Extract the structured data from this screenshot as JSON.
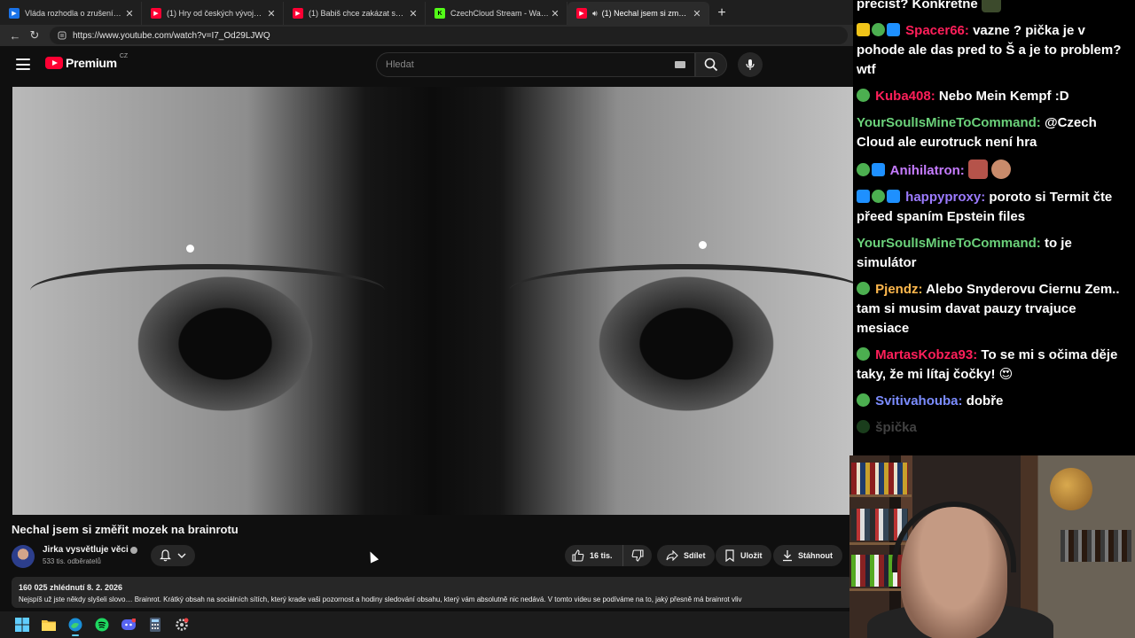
{
  "browser": {
    "tabs": [
      {
        "title": "Vláda rozhodla o zrušení Národ",
        "favicon_color": "#1a73e8",
        "favicon_glyph": "▶",
        "active": false
      },
      {
        "title": "(1) Hry od českých vývojářů dobyv",
        "favicon_color": "#ff0033",
        "favicon_glyph": "▶",
        "active": false
      },
      {
        "title": "(1) Babiš chce zakázat sociální sítě",
        "favicon_color": "#ff0033",
        "favicon_glyph": "▶",
        "active": false
      },
      {
        "title": "CzechCloud Stream - Watch Live o",
        "favicon_color": "#53fc18",
        "favicon_glyph": "K",
        "active": false
      },
      {
        "title": "(1) Nechal jsem si změřit moz",
        "favicon_color": "#ff0033",
        "favicon_glyph": "▶",
        "active": true
      }
    ],
    "url": "https://www.youtube.com/watch?v=I7_Od29LJWQ"
  },
  "yt": {
    "logo_text": "Premium",
    "logo_country": "CZ",
    "search_placeholder": "Hledat"
  },
  "video": {
    "title": "Nechal jsem si změřit mozek na brainrotu",
    "channel_name": "Jirka vysvětluje věci",
    "subscribers": "533 tis. odběratelů",
    "likes": "16 tis.",
    "share_label": "Sdílet",
    "save_label": "Uložit",
    "download_label": "Stáhnout",
    "views_date": "160 025 zhlédnutí  8. 2. 2026",
    "description": "Nejspíš už jste někdy slyšeli slovo… Brainrot. Krátký obsah na sociálních sítích, který krade vaši pozornost a hodiny sledování obsahu, který vám absolutně nic nedává. V tomto videu se podíváme na to, jaký přesně má brainrot vliv"
  },
  "taskbar": {
    "icons": [
      "windows-start-icon",
      "file-explorer-icon",
      "edge-browser-icon",
      "spotify-icon",
      "discord-icon",
      "calculator-icon",
      "settings-app-icon"
    ]
  },
  "chat": {
    "messages": [
      {
        "badges": [],
        "user": "",
        "user_color": "#ffffff",
        "text": "precist? Konkretne"
      },
      {
        "badges": [
          "#f0c419",
          "#4caf50",
          "#1e90ff"
        ],
        "user": "Spacer66",
        "user_color": "#ff1f5a",
        "text": "vazne ? pička je v pohode ale das pred to Š a je to problem? wtf"
      },
      {
        "badges": [
          "#4caf50"
        ],
        "user": "Kuba408",
        "user_color": "#ff1f5a",
        "text": "Nebo Mein Kempf :D"
      },
      {
        "badges": [],
        "user": "YourSoulIsMineToCommand",
        "user_color": "#6bd17a",
        "text": "@Czech Cloud ale eurotruck není hra"
      },
      {
        "badges": [
          "#4caf50",
          "#1e90ff"
        ],
        "user": "Anihilatron",
        "user_color": "#c57bff",
        "text": ""
      },
      {
        "badges": [
          "#1e90ff",
          "#4caf50",
          "#1e90ff"
        ],
        "user": "happyproxy",
        "user_color": "#9c7bff",
        "text": "poroto si Termit čte přeed spaním Epstein files"
      },
      {
        "badges": [],
        "user": "YourSoulIsMineToCommand",
        "user_color": "#6bd17a",
        "text": "to je simulátor"
      },
      {
        "badges": [
          "#4caf50"
        ],
        "user": "Pjendz",
        "user_color": "#ffb84d",
        "text": "Alebo Snyderovu Ciernu Zem.. tam si musim davat pauzy trvajuce mesiace"
      },
      {
        "badges": [
          "#4caf50"
        ],
        "user": "MartasKobza93",
        "user_color": "#ff1f5a",
        "text": "To se mi s očima děje taky, že mi lítaj čočky! 😍"
      },
      {
        "badges": [
          "#4caf50"
        ],
        "user": "Svitivahouba",
        "user_color": "#7b8cff",
        "text": "dobře"
      },
      {
        "badges": [
          "#4caf50"
        ],
        "user": "",
        "user_color": "#5a1b1b",
        "text": "špička"
      }
    ]
  }
}
